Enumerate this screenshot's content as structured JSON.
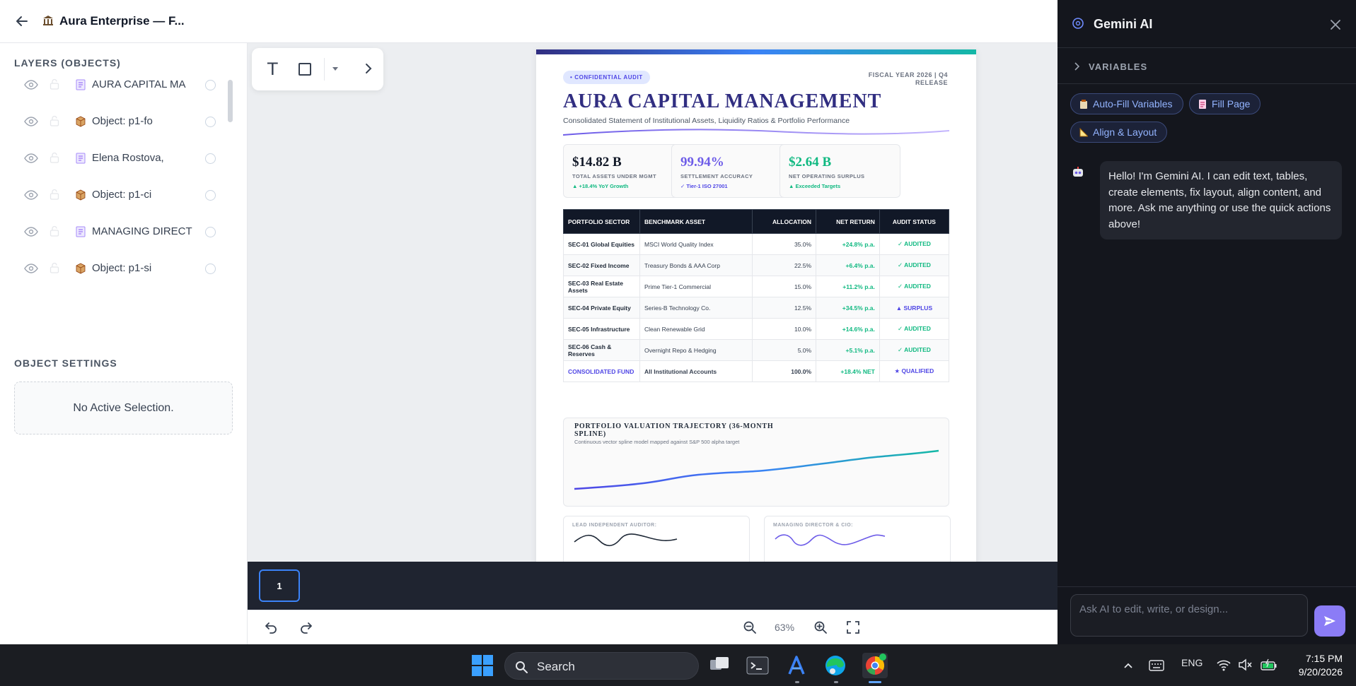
{
  "header": {
    "title": "Aura Enterprise — F...",
    "back_icon": "arrow-left-icon",
    "doc_icon": "bank-icon"
  },
  "layers": {
    "section_title": "LAYERS (OBJECTS)",
    "items": [
      {
        "label": "AURA CAPITAL MA",
        "type": "text"
      },
      {
        "label": "Object: p1-fo",
        "type": "object"
      },
      {
        "label": "Elena Rostova,",
        "type": "text"
      },
      {
        "label": "Object: p1-ci",
        "type": "object"
      },
      {
        "label": "MANAGING DIRECT",
        "type": "text"
      },
      {
        "label": "Object: p1-si",
        "type": "object"
      }
    ]
  },
  "object_settings": {
    "section_title": "OBJECT SETTINGS",
    "empty_text": "No Active Selection."
  },
  "toolbar": {
    "text_tool": "T"
  },
  "document": {
    "badge": "• CONFIDENTIAL AUDIT",
    "fiscal_line1": "FISCAL YEAR 2026 | Q4",
    "fiscal_line2": "RELEASE",
    "title": "AURA CAPITAL MANAGEMENT",
    "subtitle": "Consolidated Statement of Institutional Assets, Liquidity Ratios & Portfolio Performance",
    "kpis": [
      {
        "value": "$14.82 B",
        "label": "TOTAL ASSETS UNDER MGMT",
        "delta": "▲ +18.4% YoY Growth",
        "value_color": "#111827",
        "delta_color": "#10b981"
      },
      {
        "value": "99.94%",
        "label": "SETTLEMENT ACCURACY",
        "delta": "✓ Tier-1 ISO 27001",
        "value_color": "#6d5ce8",
        "delta_color": "#4f46e5"
      },
      {
        "value": "$2.64 B",
        "label": "NET OPERATING SURPLUS",
        "delta": "▲ Exceeded Targets",
        "value_color": "#10b981",
        "delta_color": "#10b981"
      }
    ],
    "table": {
      "headers": [
        "PORTFOLIO SECTOR",
        "BENCHMARK ASSET",
        "ALLOCATION",
        "NET RETURN",
        "AUDIT STATUS"
      ],
      "rows": [
        [
          "SEC-01 Global Equities",
          "MSCI World Quality Index",
          "35.0%",
          "+24.8% p.a.",
          "✓ AUDITED"
        ],
        [
          "SEC-02 Fixed Income",
          "Treasury Bonds & AAA Corp",
          "22.5%",
          "+6.4% p.a.",
          "✓ AUDITED"
        ],
        [
          "SEC-03 Real Estate Assets",
          "Prime Tier-1 Commercial",
          "15.0%",
          "+11.2% p.a.",
          "✓ AUDITED"
        ],
        [
          "SEC-04 Private Equity",
          "Series-B Technology Co.",
          "12.5%",
          "+34.5% p.a.",
          "▲ SURPLUS"
        ],
        [
          "SEC-05 Infrastructure",
          "Clean Renewable Grid",
          "10.0%",
          "+14.6% p.a.",
          "✓ AUDITED"
        ],
        [
          "SEC-06 Cash & Reserves",
          "Overnight Repo & Hedging",
          "5.0%",
          "+5.1% p.a.",
          "✓ AUDITED"
        ]
      ],
      "total": [
        "CONSOLIDATED FUND",
        "All Institutional Accounts",
        "100.0%",
        "+18.4% NET",
        "★ QUALIFIED"
      ]
    },
    "chart": {
      "title": "PORTFOLIO VALUATION TRAJECTORY (36-MONTH SPLINE)",
      "subtitle": "Continuous vector spline model mapped against S&P 500 alpha target"
    },
    "signatures": [
      {
        "label": "LEAD INDEPENDENT AUDITOR:",
        "color": "#1f2937"
      },
      {
        "label": "MANAGING DIRECTOR & CIO:",
        "color": "#6d5ce8"
      }
    ]
  },
  "pages": {
    "current": "1"
  },
  "zoom": {
    "label": "63%"
  },
  "assistant": {
    "title": "Gemini AI",
    "variables_label": "VARIABLES",
    "chips": [
      "Auto-Fill Variables",
      "Fill Page",
      "Align & Layout"
    ],
    "message": "Hello! I'm Gemini AI. I can edit text, tables, create elements, fix layout, align content, and more. Ask me anything or use the quick actions above!",
    "input_placeholder": "Ask AI to edit, write, or design..."
  },
  "taskbar": {
    "search_label": "Search",
    "language": "ENG",
    "time": "7:15 PM",
    "date": "9/20/2026"
  }
}
